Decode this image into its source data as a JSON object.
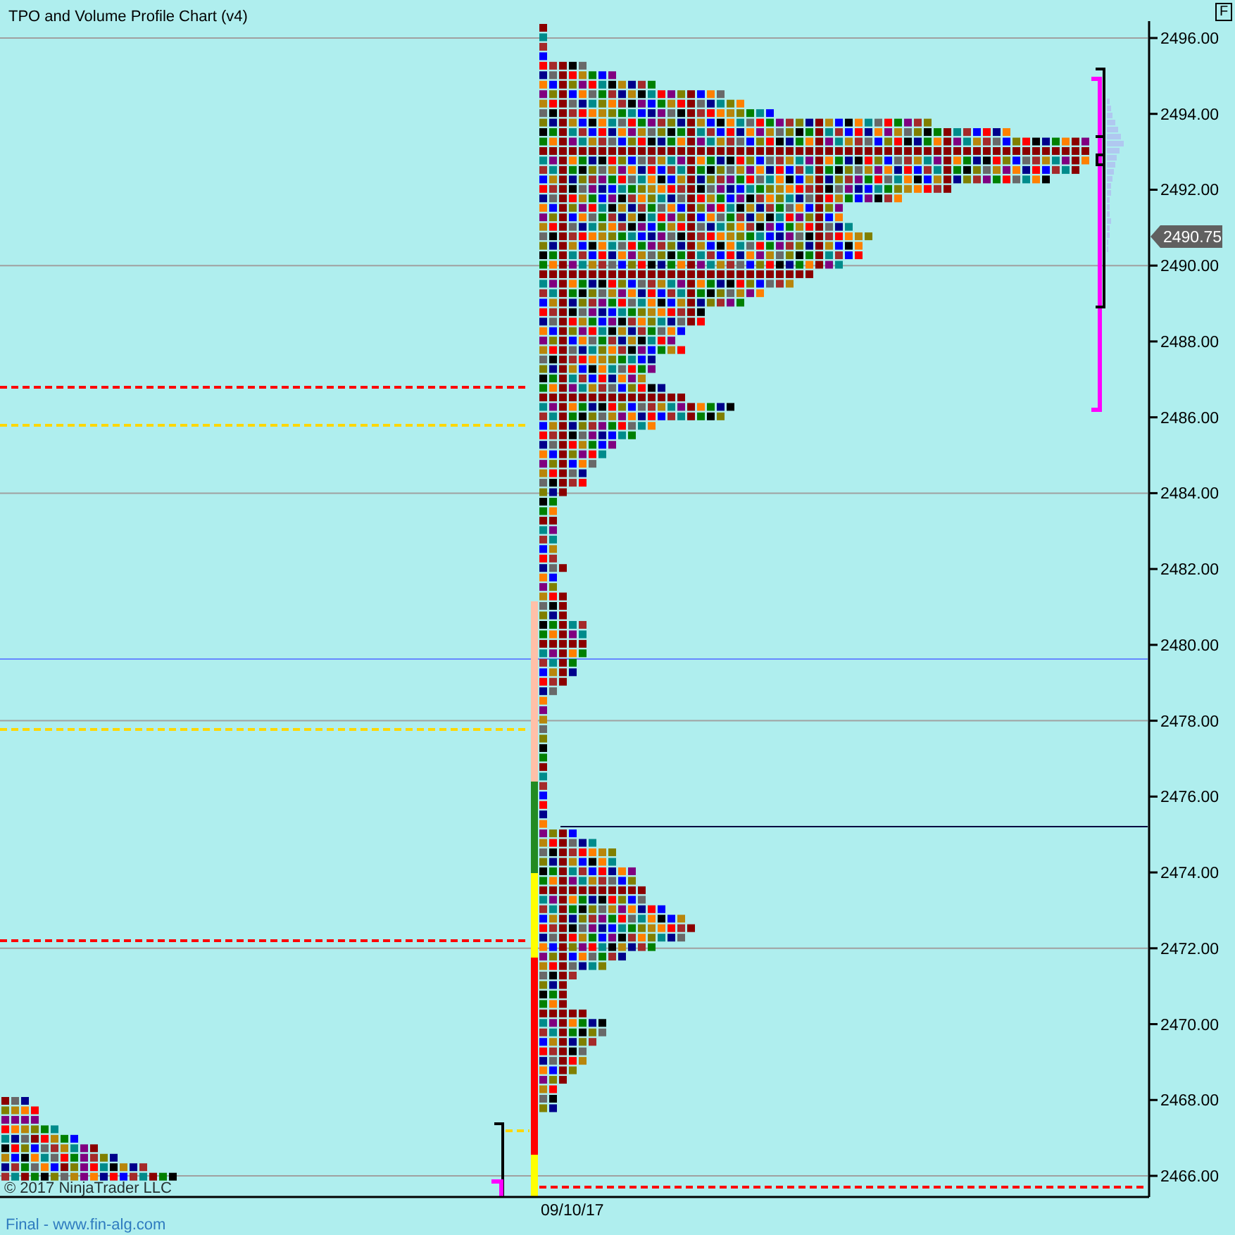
{
  "title": "TPO and Volume Profile Chart (v4)",
  "mode_button": "F",
  "price_axis": {
    "labels": [
      "2496.00",
      "2494.00",
      "2492.00",
      "2490.00",
      "2488.00",
      "2486.00",
      "2484.00",
      "2482.00",
      "2480.00",
      "2478.00",
      "2476.00",
      "2474.00",
      "2472.00",
      "2470.00",
      "2468.00",
      "2466.00"
    ]
  },
  "last_price": "2490.75",
  "date_label": "09/10/17",
  "copyright": "© 2017 NinjaTrader LLC",
  "footer": "Final - www.fin-alg.com"
}
